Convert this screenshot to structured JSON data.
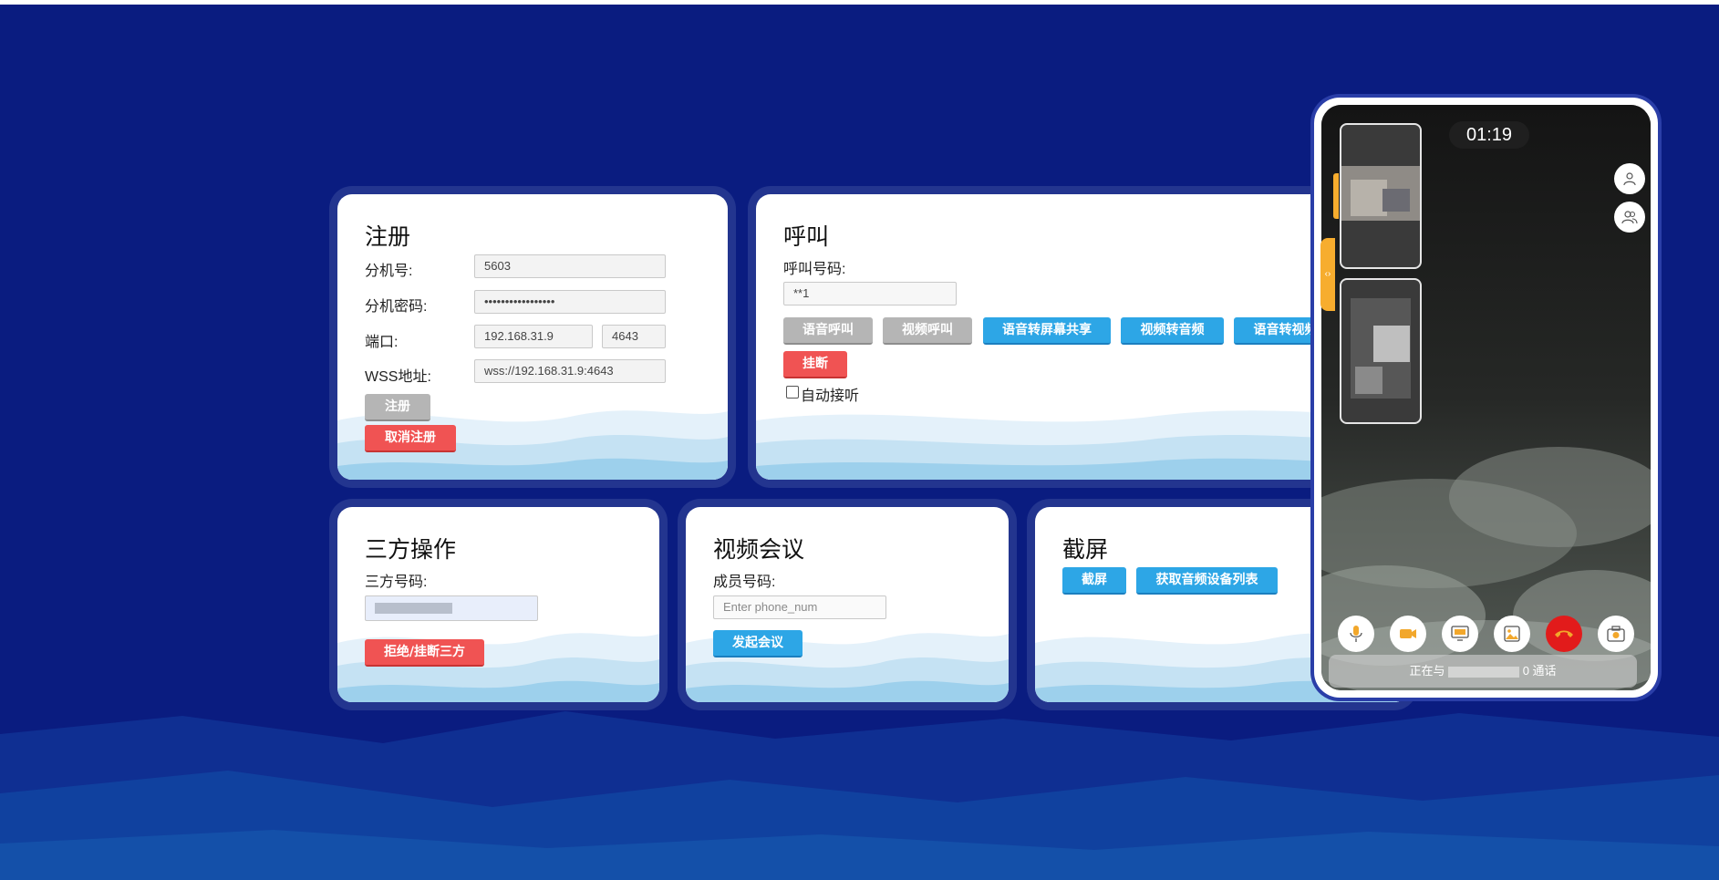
{
  "register": {
    "title": "注册",
    "ext_label": "分机号:",
    "ext_value": "5603",
    "pwd_label": "分机密码:",
    "pwd_value": "•••••••••••••••••",
    "port_label": "端口:",
    "ip_value": "192.168.31.9",
    "port_value": "4643",
    "wss_label": "WSS地址:",
    "wss_value": "wss://192.168.31.9:4643",
    "register_btn": "注册",
    "unregister_btn": "取消注册"
  },
  "call": {
    "title": "呼叫",
    "number_label": "呼叫号码:",
    "number_value": "**1",
    "buttons": [
      "语音呼叫",
      "视频呼叫",
      "语音转屏幕共享",
      "视频转音频",
      "语音转视频"
    ],
    "hangup_btn": "挂断",
    "auto_answer": "自动接听"
  },
  "three_way": {
    "title": "三方操作",
    "number_label": "三方号码:",
    "reject_btn": "拒绝/挂断三方"
  },
  "conference": {
    "title": "视频会议",
    "member_label": "成员号码:",
    "member_placeholder": "Enter phone_num",
    "start_btn": "发起会议"
  },
  "screenshot": {
    "title": "截屏",
    "capture_btn": "截屏",
    "devices_btn": "获取音频设备列表"
  },
  "phone": {
    "timer": "01:19",
    "status_prefix": "正在与",
    "status_suffix": "0 通话",
    "edge_arrow": "‹›"
  },
  "colors": {
    "background": "#0a1c80",
    "primary_button": "#2da6e6",
    "danger_button": "#f05353",
    "disabled_button": "#b5b5b5",
    "accent_tab": "#f7ad2e"
  }
}
